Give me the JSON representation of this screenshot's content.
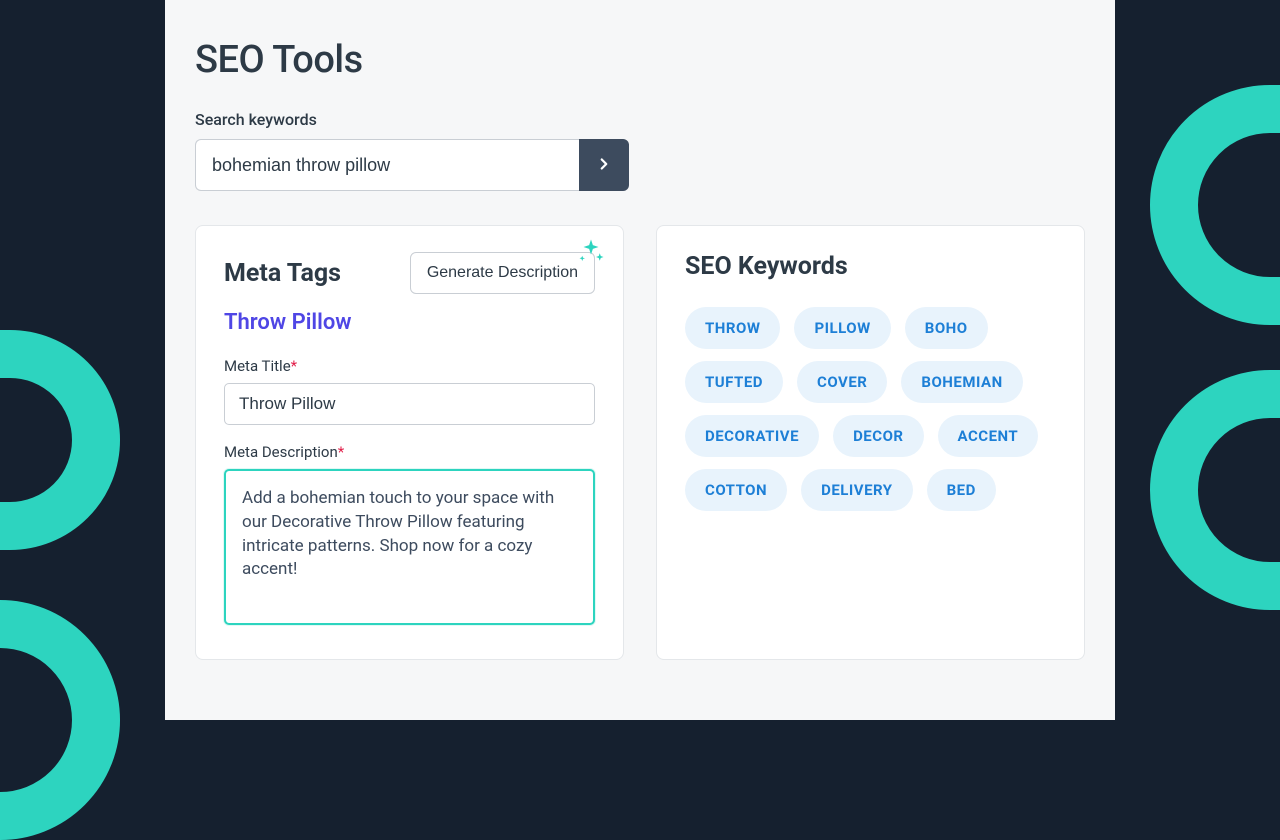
{
  "page": {
    "title": "SEO Tools"
  },
  "search": {
    "label": "Search keywords",
    "value": "bohemian throw pillow"
  },
  "meta": {
    "panel_title": "Meta Tags",
    "generate_label": "Generate Description",
    "product_name": "Throw Pillow",
    "title_label": "Meta Title",
    "title_value": "Throw Pillow",
    "description_label": "Meta Description",
    "description_value": "Add a bohemian touch to your space with our Decorative Throw Pillow featuring intricate patterns. Shop now for a cozy accent!"
  },
  "keywords": {
    "panel_title": "SEO Keywords",
    "items": [
      "THROW",
      "PILLOW",
      "BOHO",
      "TUFTED",
      "COVER",
      "BOHEMIAN",
      "DECORATIVE",
      "DECOR",
      "ACCENT",
      "COTTON",
      "DELIVERY",
      "BED"
    ]
  }
}
